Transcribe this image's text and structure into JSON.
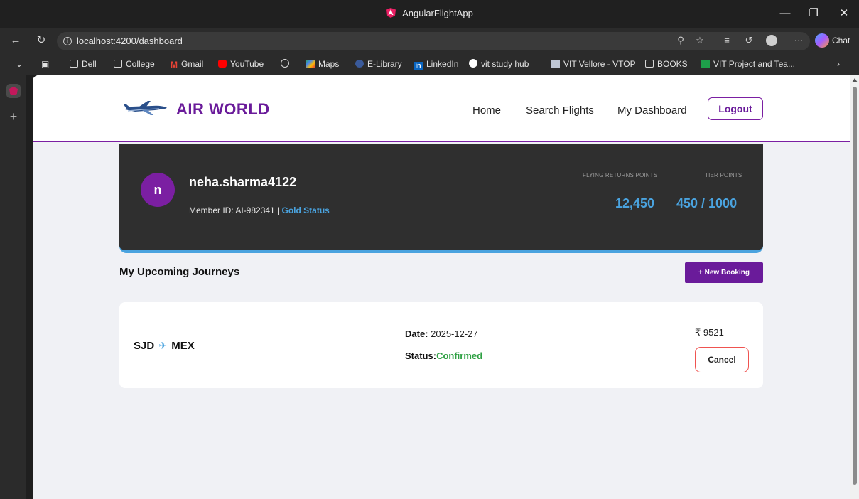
{
  "window": {
    "title": "AngularFlightApp",
    "minimize_icon": "minimize-icon",
    "restore_icon": "restore-icon",
    "close_icon": "close-icon"
  },
  "browser": {
    "url": "localhost:4200/dashboard",
    "chat_label": "Chat",
    "more_label": "···"
  },
  "bookmarks": [
    {
      "label": "Dell",
      "icon": "folder-icon"
    },
    {
      "label": "College",
      "icon": "folder-icon"
    },
    {
      "label": "Gmail",
      "icon": "gmail-icon"
    },
    {
      "label": "YouTube",
      "icon": "youtube-icon"
    },
    {
      "label": "",
      "icon": "globe-icon"
    },
    {
      "label": "Maps",
      "icon": "maps-icon"
    },
    {
      "label": "E-Library",
      "icon": "library-icon"
    },
    {
      "label": "LinkedIn",
      "icon": "linkedin-icon"
    },
    {
      "label": "vit study hub",
      "icon": "study-hub-icon"
    },
    {
      "label": "VIT Vellore - VTOP",
      "icon": "vtop-icon"
    },
    {
      "label": "BOOKS",
      "icon": "folder-icon"
    },
    {
      "label": "VIT Project and Tea...",
      "icon": "sheets-icon"
    }
  ],
  "site": {
    "brand": "AIR WORLD",
    "nav": {
      "home": "Home",
      "search": "Search Flights",
      "dashboard": "My Dashboard",
      "logout": "Logout"
    }
  },
  "member": {
    "avatar_initial": "n",
    "username": "neha.sharma4122",
    "member_id_text": "Member ID: AI-982341 | ",
    "status": "Gold Status",
    "points_label": "FLYING RETURNS POINTS",
    "points_value": "12,450",
    "tier_label": "TIER POINTS",
    "tier_value": "450 / 1000"
  },
  "journeys": {
    "heading": "My Upcoming Journeys",
    "new_booking_label": "+ New Booking",
    "items": [
      {
        "from": "SJD",
        "to": "MEX",
        "date_label": "Date:",
        "date": "2025-12-27",
        "status_label": "Status:",
        "status": "Confirmed",
        "price": "₹ 9521",
        "cancel_label": "Cancel"
      }
    ]
  },
  "colors": {
    "brand_purple": "#6a1b9a",
    "accent_blue": "#4aa3df",
    "confirmed_green": "#2ea043",
    "cancel_red": "#ef5350"
  }
}
